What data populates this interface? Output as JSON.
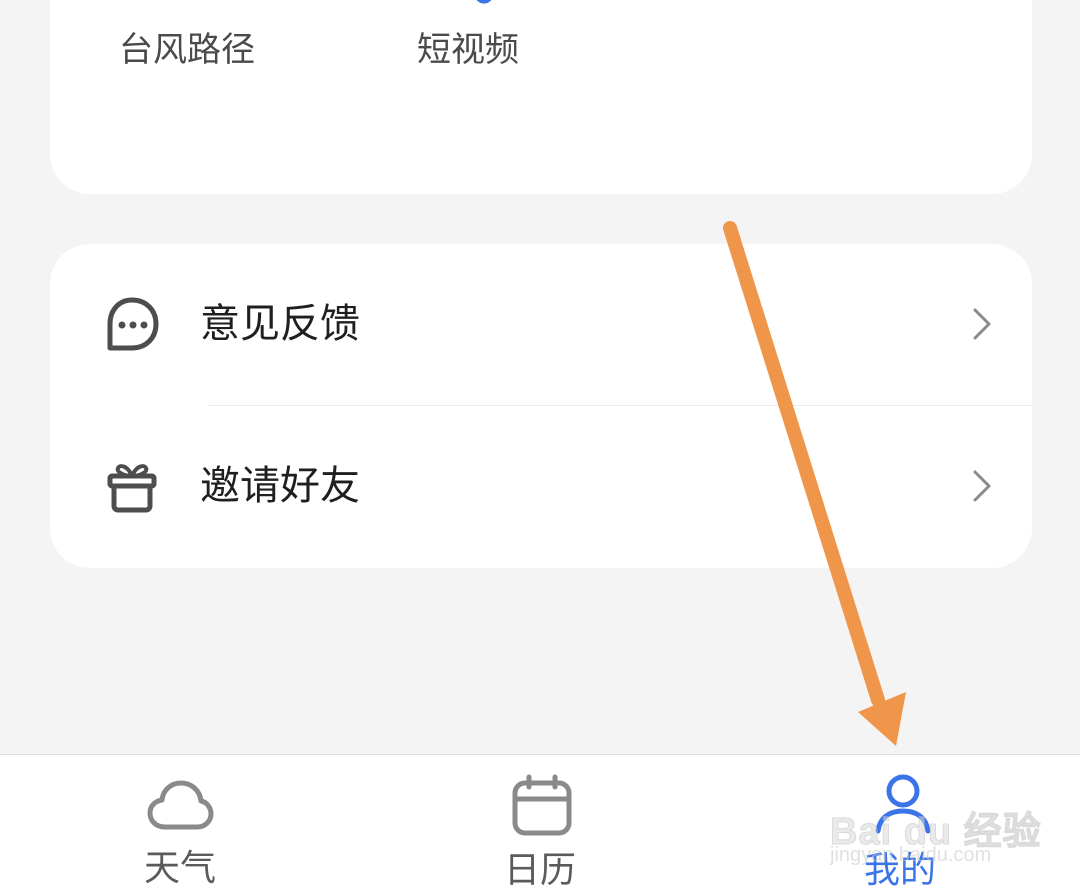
{
  "shortcuts": [
    {
      "label": "台风路径",
      "icon": "typhoon-path-icon"
    },
    {
      "label": "短视频",
      "icon": "short-video-icon"
    }
  ],
  "menu": {
    "items": [
      {
        "label": "意见反馈",
        "icon": "chat-bubble-icon"
      },
      {
        "label": "邀请好友",
        "icon": "gift-icon"
      }
    ]
  },
  "tabbar": {
    "tabs": [
      {
        "label": "天气",
        "icon": "cloud-icon",
        "active": false
      },
      {
        "label": "日历",
        "icon": "calendar-icon",
        "active": false
      },
      {
        "label": "我的",
        "icon": "profile-icon",
        "active": true
      }
    ]
  },
  "colors": {
    "accent": "#3b74e8",
    "annotation_arrow": "#f0964a",
    "background": "#f4f4f4",
    "card": "#ffffff",
    "icon_gray": "#4d4d4d"
  },
  "watermark": {
    "brand": "Bai du 经验",
    "url": "jingyan.baidu.com"
  }
}
